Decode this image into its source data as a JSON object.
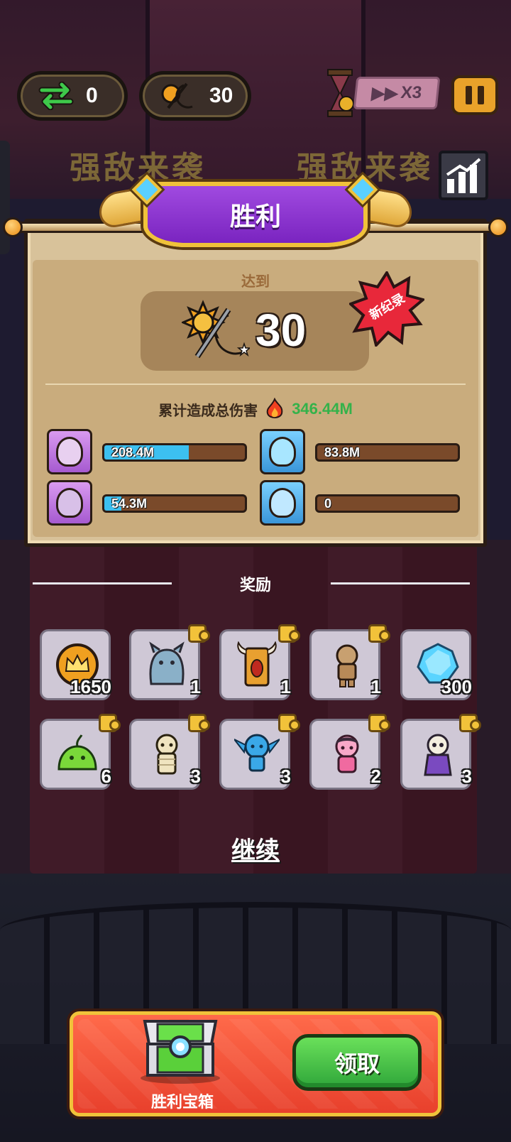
{
  "hud": {
    "swap_count": "0",
    "wave_count": "30",
    "speed_label": "X3"
  },
  "enemy_banner": {
    "left": "强敌来袭",
    "right": "强敌来袭"
  },
  "result": {
    "title": "胜利",
    "reached_label": "达到",
    "score": "30",
    "new_record_label": "新纪录",
    "total_damage_label": "累计造成总伤害",
    "total_damage_value": "346.44M",
    "heroes": [
      {
        "name": "flower-mage",
        "damage": "208.4M",
        "fill": 0.6
      },
      {
        "name": "jellyfish",
        "damage": "83.8M",
        "fill": 0.0
      },
      {
        "name": "winged-knight",
        "damage": "54.3M",
        "fill": 0.12
      },
      {
        "name": "ice-golem",
        "damage": "0",
        "fill": 0.0
      }
    ]
  },
  "rewards": {
    "title": "奖励",
    "items": [
      {
        "name": "crown-coin",
        "count": "1650"
      },
      {
        "name": "blue-monster",
        "count": "1"
      },
      {
        "name": "totem",
        "count": "1"
      },
      {
        "name": "dummy",
        "count": "1"
      },
      {
        "name": "ice-crystal",
        "count": "300"
      },
      {
        "name": "green-slime",
        "count": "6"
      },
      {
        "name": "mummy",
        "count": "3"
      },
      {
        "name": "goblin",
        "count": "3"
      },
      {
        "name": "pink-girl",
        "count": "2"
      },
      {
        "name": "skull-reaper",
        "count": "3"
      }
    ]
  },
  "continue_label": "继续",
  "chest": {
    "label": "胜利宝箱",
    "claim_label": "领取"
  },
  "colors": {
    "accent_purple": "#8a34d0",
    "accent_gold": "#f0c23a",
    "damage_green": "#34b24a",
    "claim_green": "#2fa63a"
  }
}
